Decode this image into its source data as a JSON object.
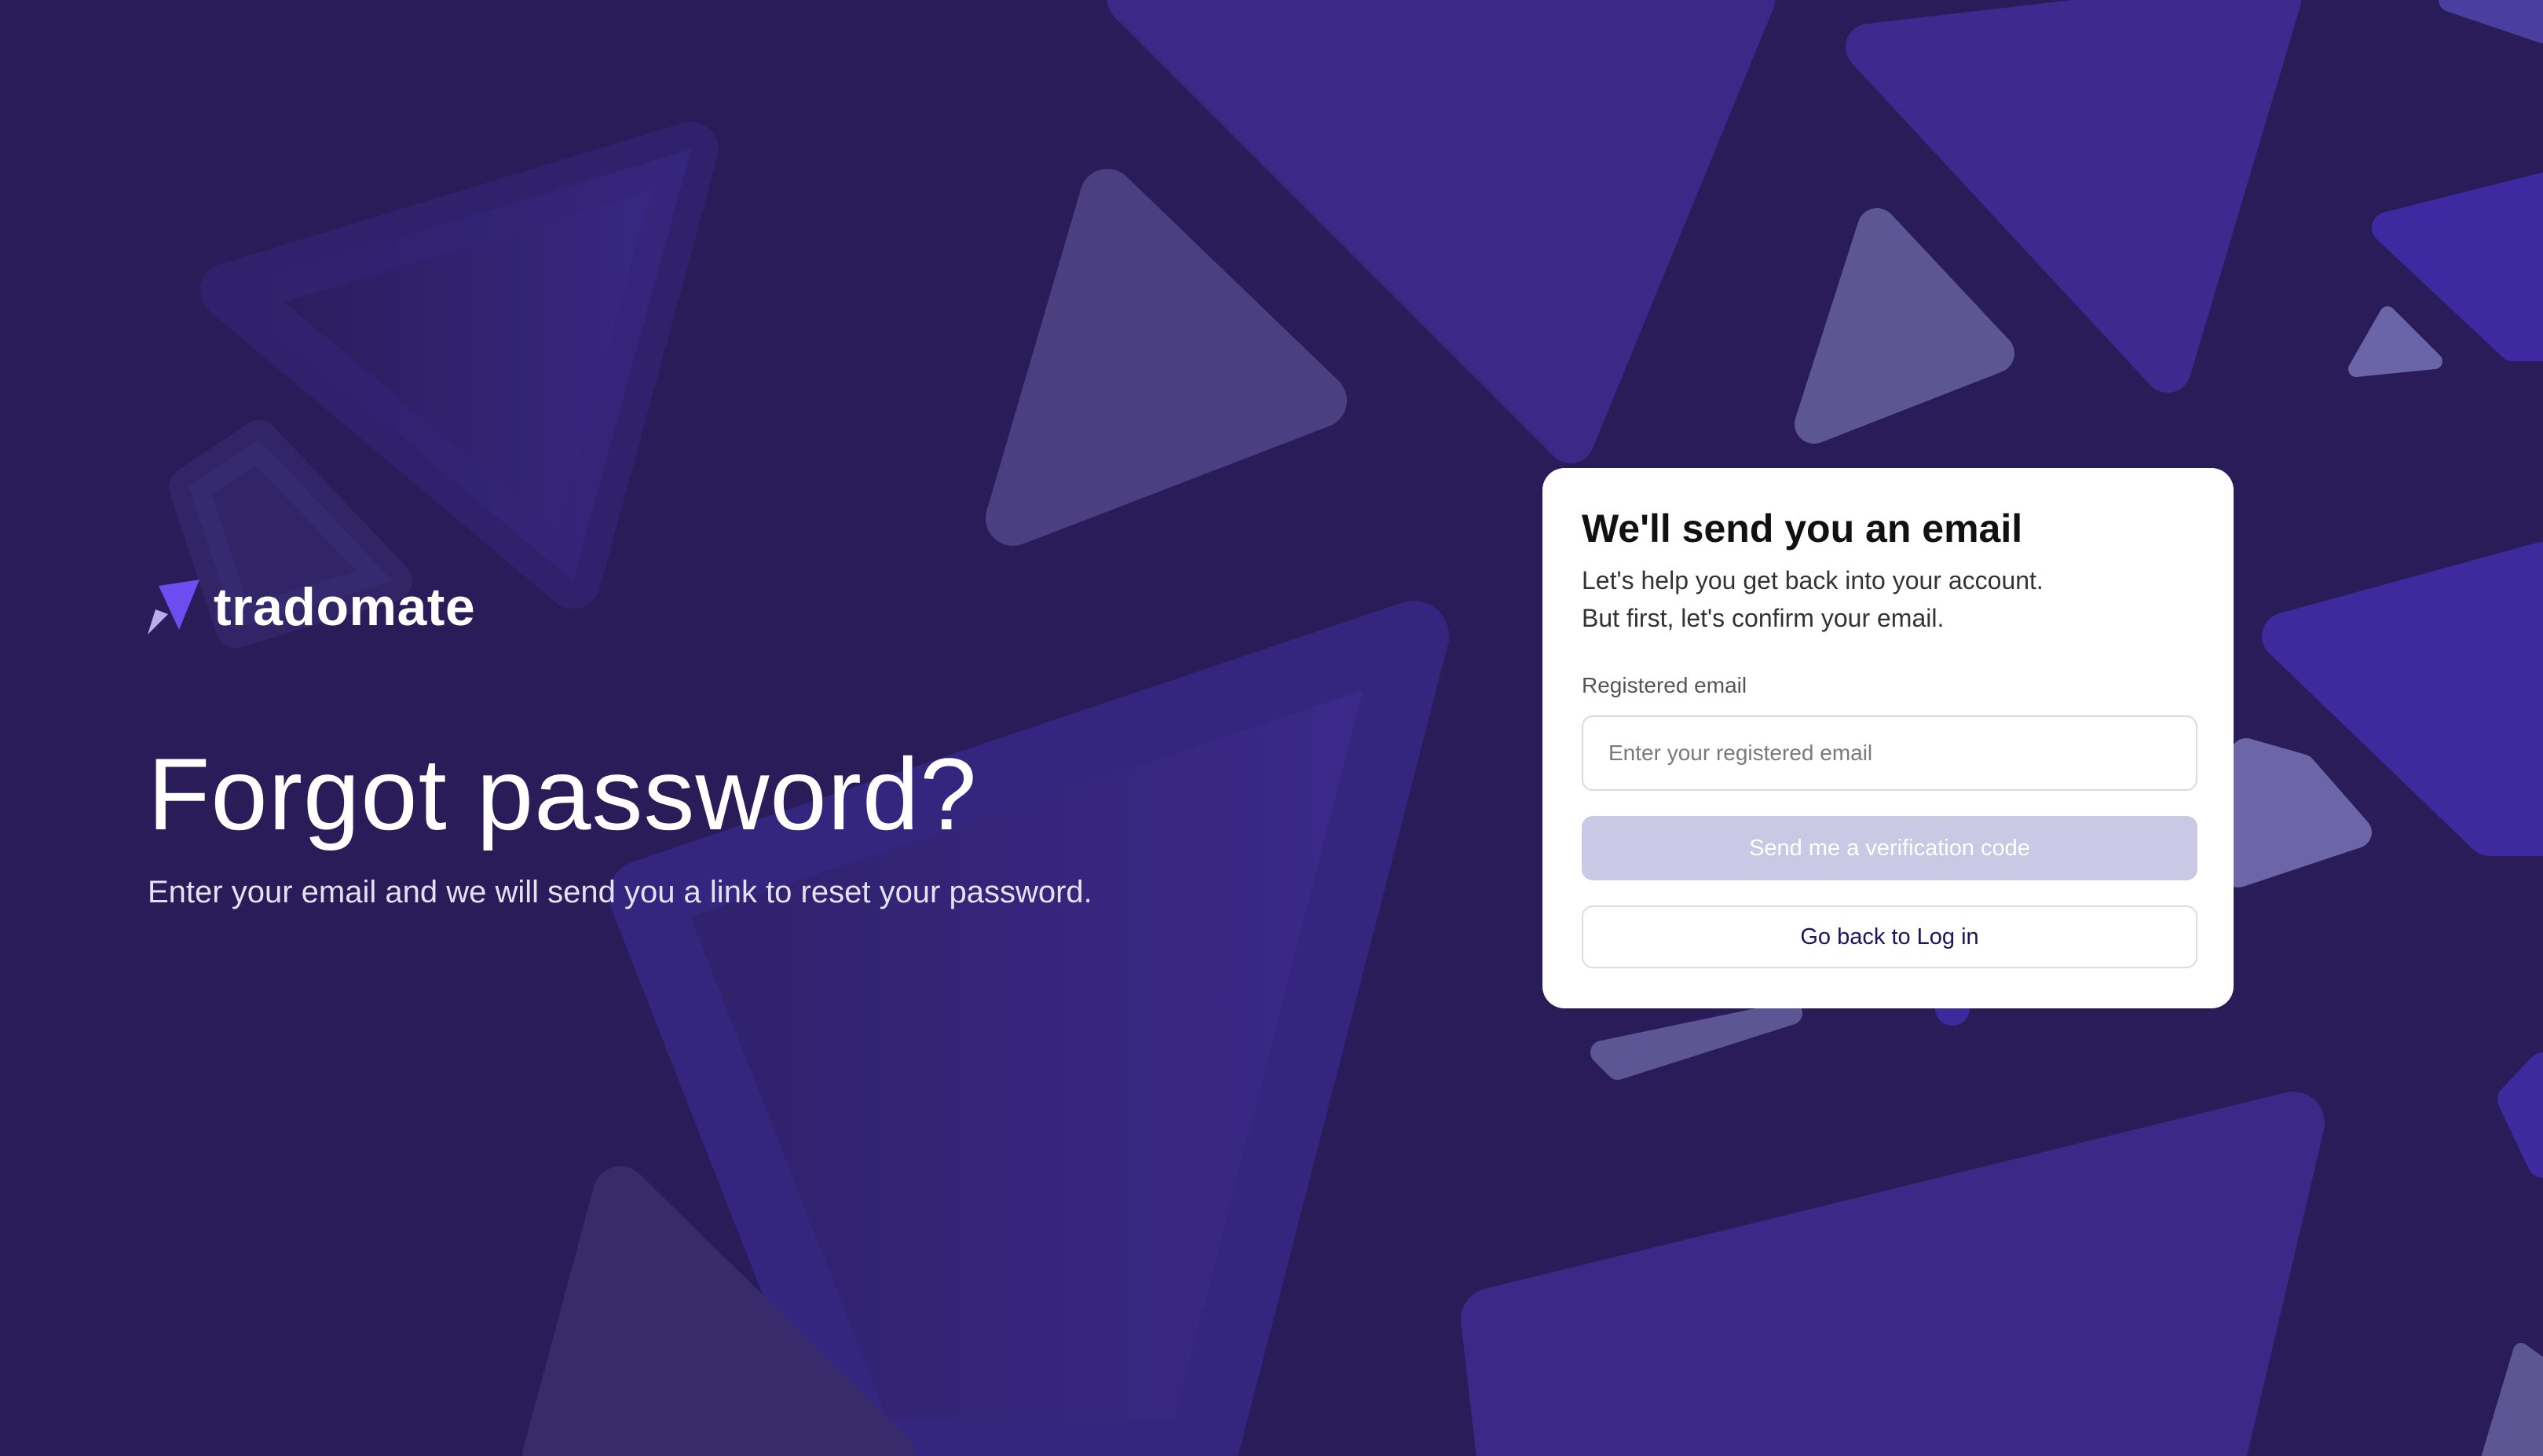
{
  "brand": {
    "name": "tradomate",
    "logo_icon": "paper-plane-icon"
  },
  "hero": {
    "title": "Forgot password?",
    "subtitle": "Enter your email and we will send you a link to reset your password."
  },
  "card": {
    "title": "We'll send you an email",
    "desc_line1": "Let's help you get back into your account.",
    "desc_line2": "But first, let's confirm your email.",
    "email_label": "Registered email",
    "email_placeholder": "Enter your registered email",
    "email_value": "",
    "send_button": "Send me a verification code",
    "back_button": "Go back to Log in"
  },
  "colors": {
    "background": "#291c58",
    "triangle_purple": "#3b2a8c",
    "triangle_muted": "#5a5296",
    "button_disabled": "#c9c8e5",
    "link_text": "#1d1460"
  }
}
